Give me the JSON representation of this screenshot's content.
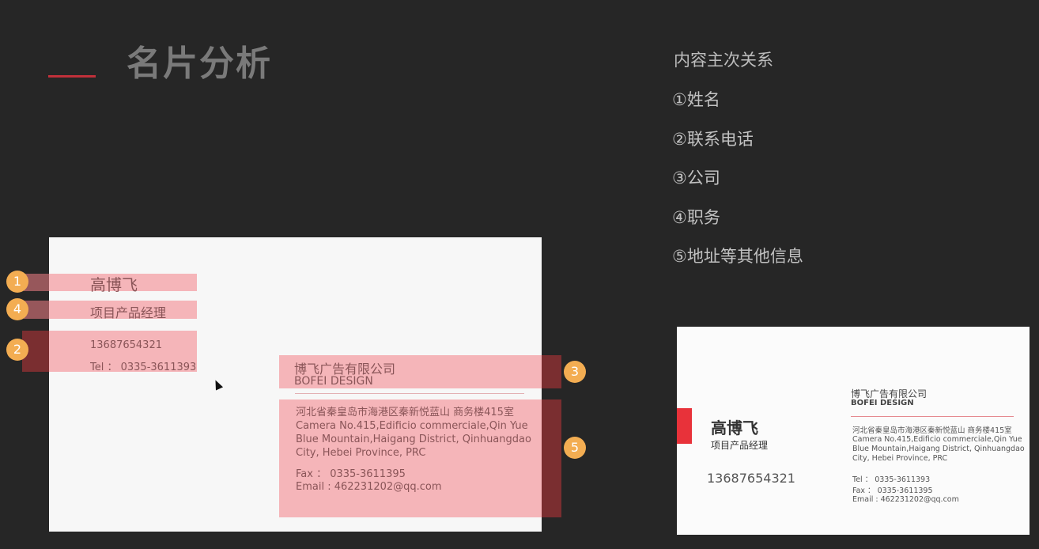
{
  "title": "名片分析",
  "relations": {
    "heading": "内容主次关系",
    "items": [
      "①姓名",
      "②联系电话",
      "③公司",
      "④职务",
      "⑤地址等其他信息"
    ]
  },
  "card_annotated": {
    "name": "高博飞",
    "position": "项目产品经理",
    "mobile": "13687654321",
    "tel": "Tel ： 0335-3611393",
    "company_cn": "博飞广告有限公司",
    "company_en": "BOFEI DESIGN",
    "address_cn": "河北省秦皇岛市海港区秦新悦蓝山 商务楼415室",
    "address_en_1": "Camera No.415,Edificio commerciale,Qin Yue",
    "address_en_2": "Blue Mountain,Haigang District, Qinhuangdao",
    "address_en_3": "City, Hebei Province, PRC",
    "fax": "Fax ： 0335-3611395",
    "email": "Email : 462231202@qq.com",
    "markers": [
      "1",
      "4",
      "2",
      "3",
      "5"
    ]
  },
  "card_final": {
    "name": "高博飞",
    "position": "项目产品经理",
    "mobile": "13687654321",
    "company_cn": "博飞广告有限公司",
    "company_en": "BOFEI DESIGN",
    "address_cn": "河北省秦皇岛市海港区秦新悦蓝山 商务楼415室",
    "address_en_1": "Camera No.415,Edificio commerciale,Qin Yue",
    "address_en_2": "Blue Mountain,Haigang District, Qinhuangdao",
    "address_en_3": "City, Hebei Province, PRC",
    "tel": "Tel ： 0335-3611393",
    "fax": "Fax ： 0335-3611395",
    "email": "Email : 462231202@qq.com"
  },
  "colors": {
    "background": "#262626",
    "accent": "#c0303a",
    "highlight": "#f48087",
    "marker": "#f3ad52"
  }
}
